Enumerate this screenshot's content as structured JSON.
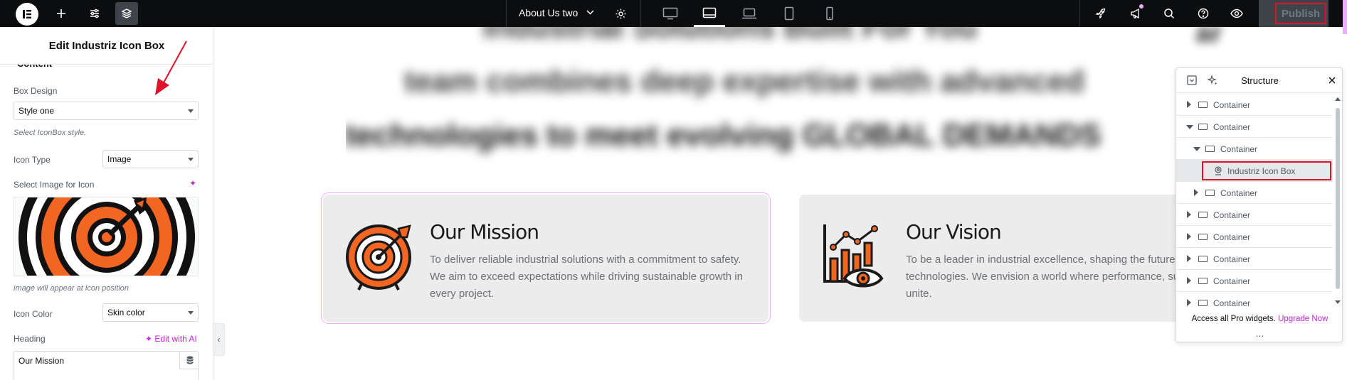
{
  "topbar": {
    "document_title": "About Us two",
    "publish_label": "Publish",
    "icons": {
      "logo": "elementor-logo-icon",
      "add": "plus-icon",
      "site_settings": "sliders-icon",
      "structure": "layers-icon",
      "page_settings": "gear-icon",
      "devices": [
        "desktop-icon",
        "tablet-landscape-icon",
        "laptop-icon",
        "tablet-icon",
        "mobile-icon"
      ],
      "right": [
        "rocket-icon",
        "megaphone-icon",
        "search-icon",
        "help-icon",
        "eye-icon"
      ]
    }
  },
  "panel": {
    "title": "Edit Industriz Icon Box",
    "section_label": "Content",
    "box_design": {
      "label": "Box Design",
      "value": "Style one",
      "hint": "Select IconBox style."
    },
    "icon_type": {
      "label": "Icon Type",
      "value": "Image"
    },
    "select_image": {
      "label": "Select Image for Icon",
      "hint": "image will appear at icon position"
    },
    "icon_color": {
      "label": "Icon Color",
      "value": "Skin color"
    },
    "heading": {
      "label": "Heading",
      "edit_ai": "Edit with AI",
      "value": "Our Mission"
    }
  },
  "canvas": {
    "blurred_lines": [
      "Industrial Solutions Built For You",
      "team combines deep expertise with advanced",
      "technologies to meet evolving GLOBAL DEMANDS"
    ],
    "cards": [
      {
        "title": "Our Mission",
        "text": "To deliver reliable industrial solutions with a commitment to safety. We aim to exceed expectations while driving sustainable growth in every project."
      },
      {
        "title": "Our Vision",
        "text": "To be a leader in industrial excellence, shaping the future through smart technologies. We envision a world where performance, sustainability, and innovation unite."
      }
    ]
  },
  "structure": {
    "title": "Structure",
    "rows": [
      {
        "label": "Container",
        "depth": 0,
        "expanded": false
      },
      {
        "label": "Container",
        "depth": 0,
        "expanded": true
      },
      {
        "label": "Container",
        "depth": 1,
        "expanded": true
      },
      {
        "label": "Industriz Icon Box",
        "depth": 2,
        "selected": true
      },
      {
        "label": "Container",
        "depth": 1,
        "expanded": false
      },
      {
        "label": "Container",
        "depth": 0,
        "expanded": false
      },
      {
        "label": "Container",
        "depth": 0,
        "expanded": false
      },
      {
        "label": "Container",
        "depth": 0,
        "expanded": false
      },
      {
        "label": "Container",
        "depth": 0,
        "expanded": false
      },
      {
        "label": "Container",
        "depth": 0,
        "expanded": false
      }
    ],
    "footer_text": "Access all Pro widgets.",
    "footer_link": "Upgrade Now"
  },
  "colors": {
    "accent_pink": "#c026d3",
    "highlight_red": "#e0112b",
    "icon_orange": "#f26522"
  }
}
